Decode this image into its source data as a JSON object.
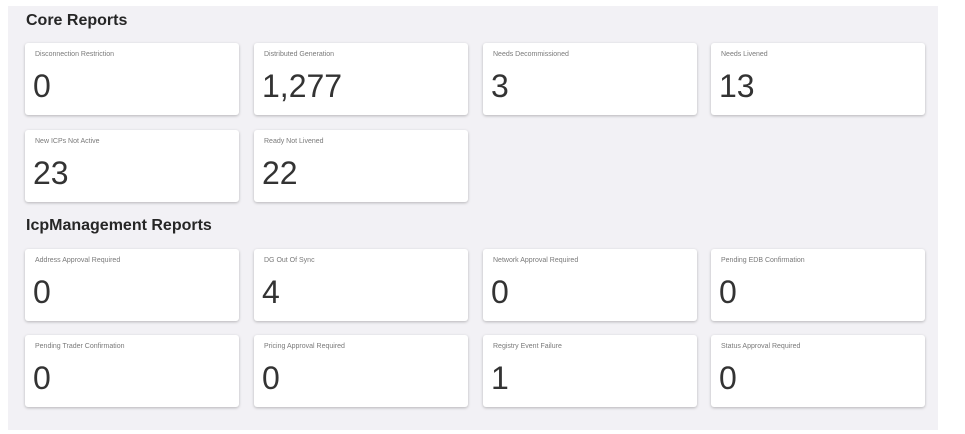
{
  "sections": [
    {
      "title": "Core Reports",
      "cards": [
        {
          "label": "Disconnection Restriction",
          "value": "0"
        },
        {
          "label": "Distributed Generation",
          "value": "1,277"
        },
        {
          "label": "Needs Decommissioned",
          "value": "3"
        },
        {
          "label": "Needs Livened",
          "value": "13"
        },
        {
          "label": "New ICPs Not Active",
          "value": "23"
        },
        {
          "label": "Ready Not Livened",
          "value": "22"
        }
      ]
    },
    {
      "title": "IcpManagement Reports",
      "cards": [
        {
          "label": "Address Approval Required",
          "value": "0"
        },
        {
          "label": "DG Out Of Sync",
          "value": "4"
        },
        {
          "label": "Network Approval Required",
          "value": "0"
        },
        {
          "label": "Pending EDB Confirmation",
          "value": "0"
        },
        {
          "label": "Pending Trader Confirmation",
          "value": "0"
        },
        {
          "label": "Pricing Approval Required",
          "value": "0"
        },
        {
          "label": "Registry Event Failure",
          "value": "1"
        },
        {
          "label": "Status Approval Required",
          "value": "0"
        }
      ]
    }
  ]
}
